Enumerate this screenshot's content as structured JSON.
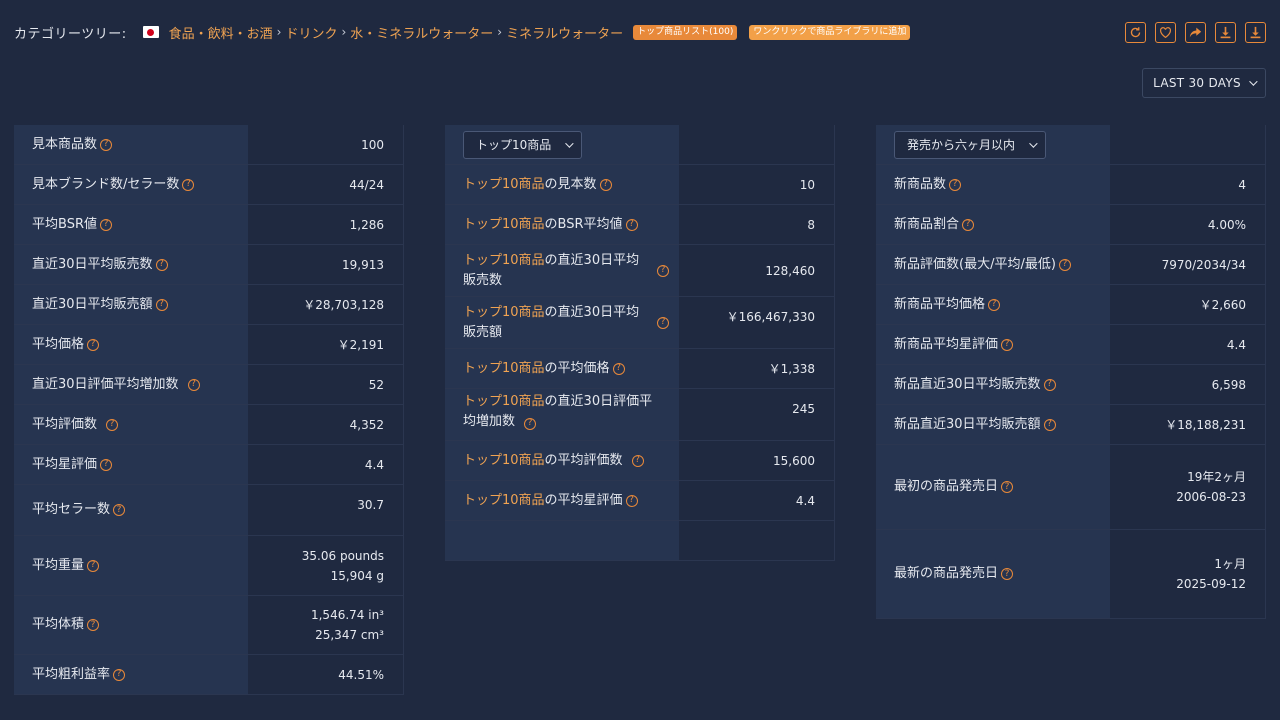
{
  "header": {
    "category_label": "カテゴリーツリー:",
    "breadcrumb": [
      "食品・飲料・お酒",
      "ドリンク",
      "水・ミネラルウォーター",
      "ミネラルウォーター"
    ],
    "badge_top_list": "トップ商品リスト(100)",
    "badge_add_library": "ワンクリックで商品ライブラリに追加",
    "tools": [
      "refresh-icon",
      "heart-icon",
      "share-icon",
      "download-icon",
      "download-alt-icon"
    ]
  },
  "range": {
    "selected": "LAST 30 DAYS"
  },
  "panel1": {
    "rows": [
      {
        "label": "見本商品数",
        "value": "100"
      },
      {
        "label": "見本ブランド数/セラー数",
        "value": "44/24"
      },
      {
        "label": "平均BSR値",
        "value": "1,286"
      },
      {
        "label": "直近30日平均販売数",
        "value": "19,913"
      },
      {
        "label": "直近30日平均販売額",
        "value": "￥28,703,128"
      },
      {
        "label": "平均価格",
        "value": "￥2,191"
      },
      {
        "label": "直近30日評価平均増加数",
        "value": "52"
      },
      {
        "label": "平均評価数",
        "value": "4,352"
      },
      {
        "label": "平均星評価",
        "value": "4.4"
      },
      {
        "label": "平均セラー数",
        "value": "30.7"
      },
      {
        "label": "平均重量",
        "value": "35.06 pounds",
        "value2": "15,904 g"
      },
      {
        "label": "平均体積",
        "value": "1,546.74 in³",
        "value2": "25,347 cm³"
      },
      {
        "label": "平均粗利益率",
        "value": "44.51%"
      }
    ]
  },
  "panel2": {
    "select": "トップ10商品",
    "prefix": "トップ10商品",
    "rows": [
      {
        "suffix": "の見本数",
        "value": "10"
      },
      {
        "suffix": "のBSR平均値",
        "value": "8"
      },
      {
        "suffix_line1": "の直近30日平均",
        "suffix_line2": "販売数",
        "value": "128,460"
      },
      {
        "suffix_line1": "の直近30日平均",
        "suffix_line2": "販売額",
        "value": "￥166,467,330"
      },
      {
        "suffix": "の平均価格",
        "value": "￥1,338"
      },
      {
        "suffix_line1": "の直近30日評価平",
        "suffix_line2": "均増加数",
        "value": "245"
      },
      {
        "suffix": "の平均評価数",
        "value": "15,600"
      },
      {
        "suffix": "の平均星評価",
        "value": "4.4"
      }
    ]
  },
  "panel3": {
    "select": "発売から六ヶ月以内",
    "rows": [
      {
        "label": "新商品数",
        "value": "4"
      },
      {
        "label": "新商品割合",
        "value": "4.00%"
      },
      {
        "label": "新品評価数(最大/平均/最低)",
        "value": "7970/2034/34"
      },
      {
        "label": "新商品平均価格",
        "value": "￥2,660"
      },
      {
        "label": "新商品平均星評価",
        "value": "4.4"
      },
      {
        "label": "新品直近30日平均販売数",
        "value": "6,598"
      },
      {
        "label": "新品直近30日平均販売額",
        "value": "￥18,188,231"
      },
      {
        "label": "最初の商品発売日",
        "value": "19年2ヶ月",
        "value2": "2006-08-23"
      },
      {
        "label": "最新の商品発売日",
        "value": "1ヶ月",
        "value2": "2025-09-12"
      }
    ]
  }
}
